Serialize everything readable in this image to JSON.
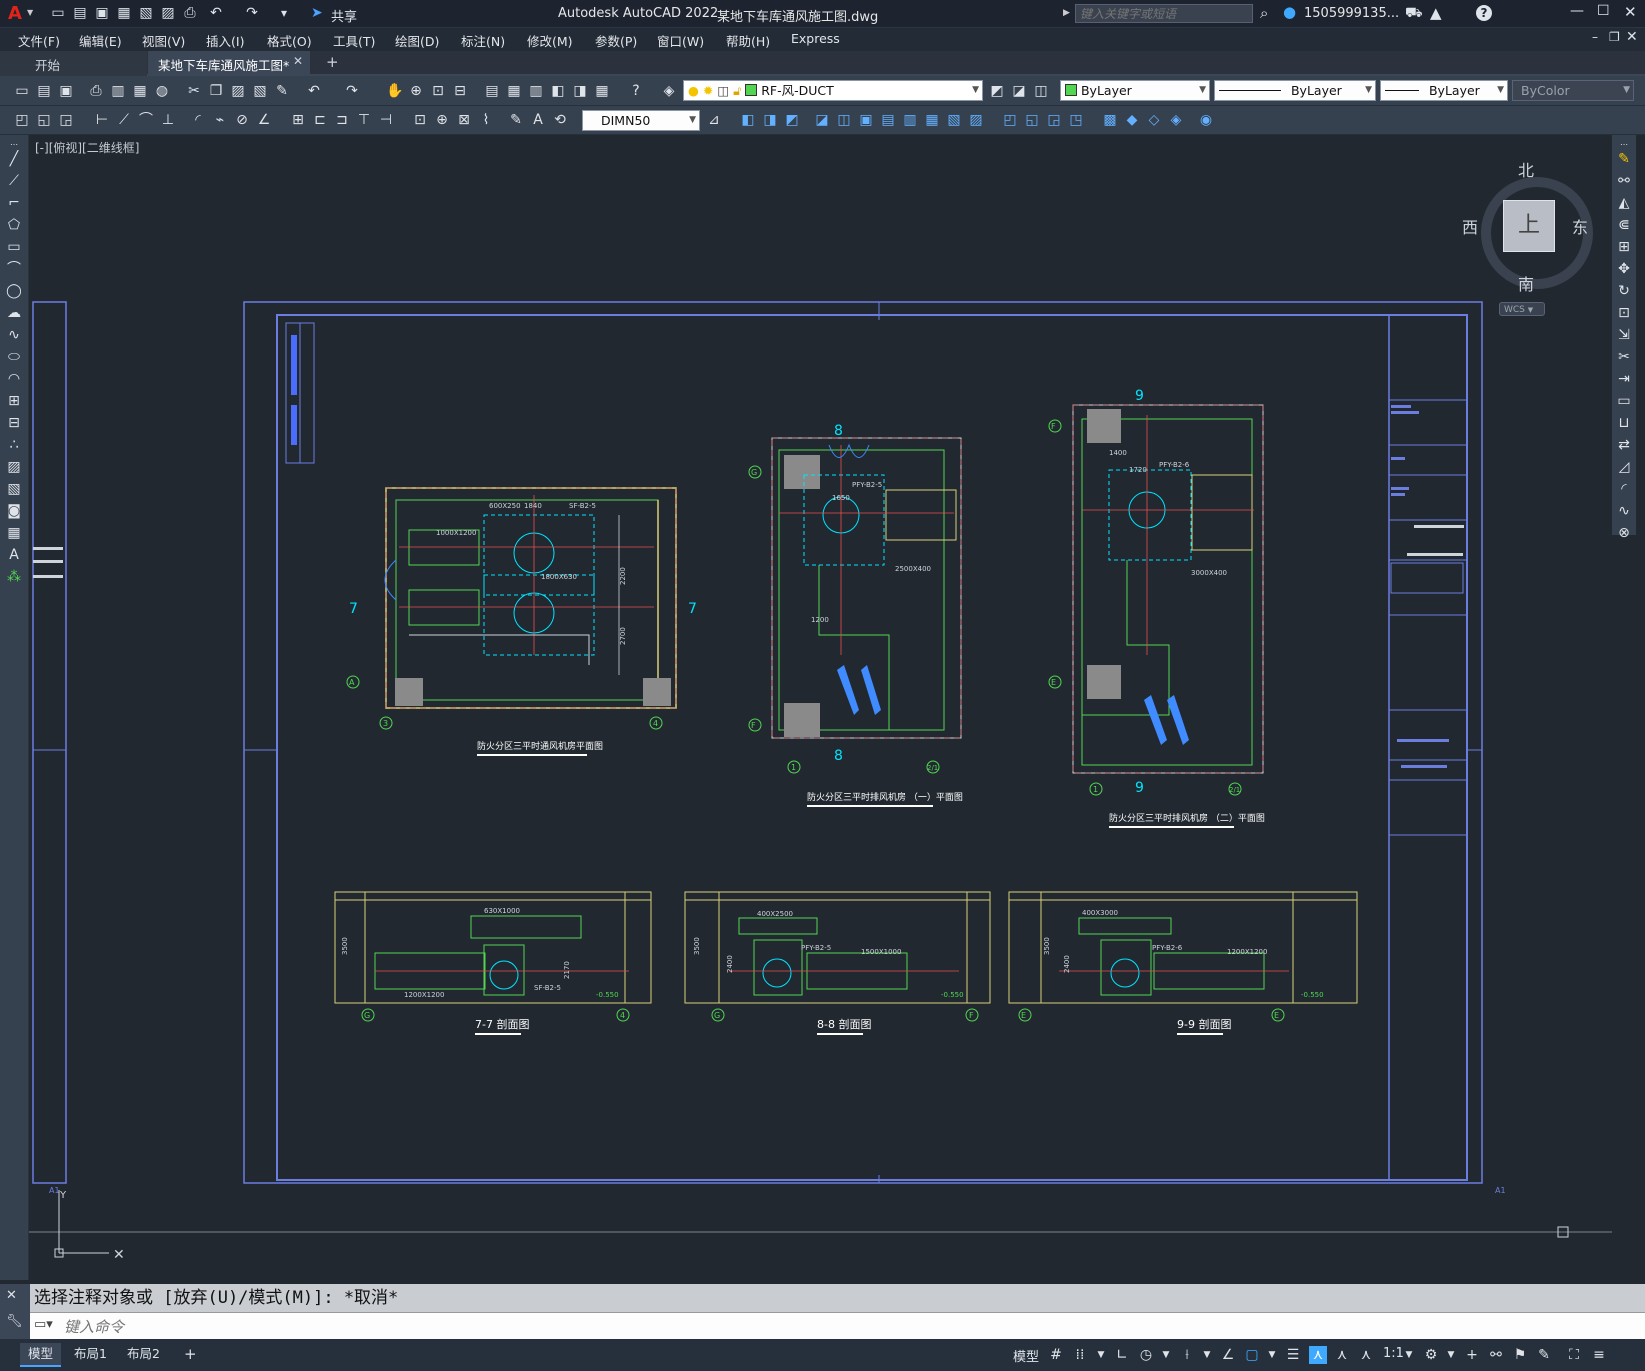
{
  "app": {
    "logo": "A",
    "title": "Autodesk AutoCAD 2022",
    "filename": "某地下车库通风施工图.dwg",
    "share_label": "共享",
    "search_placeholder": "键入关键字或短语",
    "username": "1505999135...",
    "help": "?"
  },
  "menu": [
    "文件(F)",
    "编辑(E)",
    "视图(V)",
    "插入(I)",
    "格式(O)",
    "工具(T)",
    "绘图(D)",
    "标注(N)",
    "修改(M)",
    "参数(P)",
    "窗口(W)",
    "帮助(H)",
    "Express"
  ],
  "tabs": {
    "start": "开始",
    "doc": "某地下车库通风施工图*",
    "add": "+"
  },
  "toolbar": {
    "layer": "RF-风-DUCT",
    "color": "ByLayer",
    "linetype": "ByLayer",
    "lineweight": "ByLayer",
    "plotstyle": "ByColor",
    "dimstyle": "DIMN50"
  },
  "viewport": {
    "label": "[-][俯视][二维线框]",
    "viewcube_face": "上",
    "north": "北",
    "south": "南",
    "east": "东",
    "west": "西",
    "wcs": "WCS"
  },
  "drawing": {
    "plan1_title": "防火分区三平时通风机房平面图",
    "plan2_title": "防火分区三平时排风机房 （一）平面图",
    "plan3_title": "防火分区三平时排风机房 （二）平面图",
    "sec1_title": "7-7 剖面图",
    "sec2_title": "8-8 剖面图",
    "sec3_title": "9-9 剖面图",
    "sheet_size": "A1",
    "axis_A": "A",
    "axis_3": "3",
    "axis_4": "4",
    "axis_G": "G",
    "axis_F": "F",
    "axis_1": "1",
    "axis_21": "2/1",
    "axis_E": "E",
    "sec_7": "7",
    "sec_8": "8",
    "sec_9": "9",
    "dim_1840": "1840",
    "dim_600x250": "600X250",
    "dim_1000x1200": "1000X1200",
    "dim_1800x630": "1800X630",
    "dim_2200": "2200",
    "dim_2700": "2700",
    "dim_1650": "1650",
    "dim_2500x400": "2500X400",
    "dim_1200": "1200",
    "dim_1400": "1400",
    "dim_1720": "1720",
    "dim_3000x400": "3000X400",
    "dim_630x1000": "630X1000",
    "dim_400x2500": "400X2500",
    "dim_400x3000": "400X3000",
    "dim_1500x1000": "1500X1000",
    "dim_1200x1200": "1200X1200",
    "dim_3500": "3500",
    "dim_2400": "2400",
    "dim_2170": "2170",
    "tag_sf": "SF-B2-5",
    "tag_pfy1": "PFY-B2-5",
    "tag_pfy2": "PFY-B2-6",
    "elev": "-0.550"
  },
  "command": {
    "history": "选择注释对象或 [放弃(U)/模式(M)]: *取消*",
    "placeholder": "键入命令"
  },
  "layouts": [
    "模型",
    "布局1",
    "布局2",
    "+"
  ],
  "status": {
    "model": "模型",
    "scale": "1:1"
  }
}
